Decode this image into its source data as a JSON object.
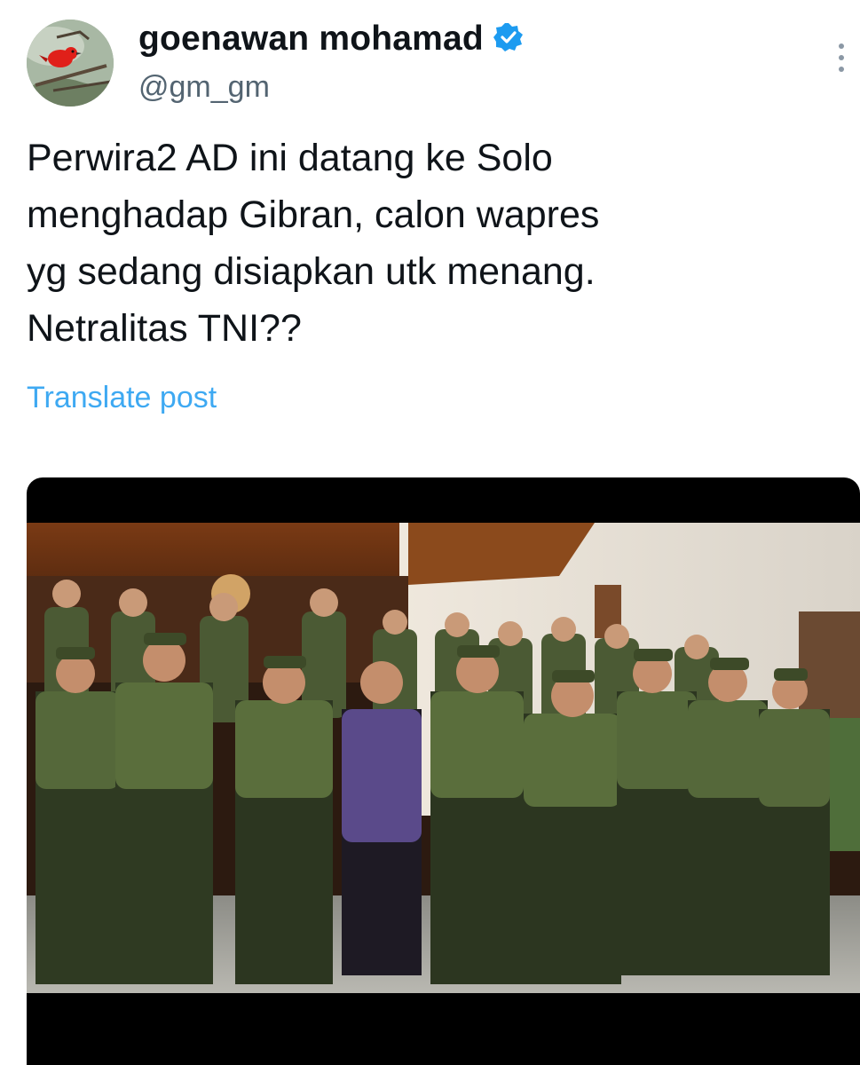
{
  "author": {
    "display_name": "goenawan mohamad",
    "handle": "@gm_gm",
    "verified": true,
    "avatar_icon": "red-bird-on-branch-avatar"
  },
  "tweet": {
    "lines": [
      "Perwira2 AD ini datang ke Solo",
      "menghadap Gibran, calon wapres",
      "yg sedang disiapkan utk menang.",
      "Netralitas TNI??"
    ],
    "translate_label": "Translate post"
  },
  "media": {
    "kind": "video-frame"
  },
  "icons": {
    "verified": "verified-badge-icon",
    "more": "more-vertical-icon"
  },
  "colors": {
    "text_primary": "#0f1419",
    "text_secondary": "#536471",
    "link": "#1d9bf0",
    "badge": "#1d9bf0"
  }
}
